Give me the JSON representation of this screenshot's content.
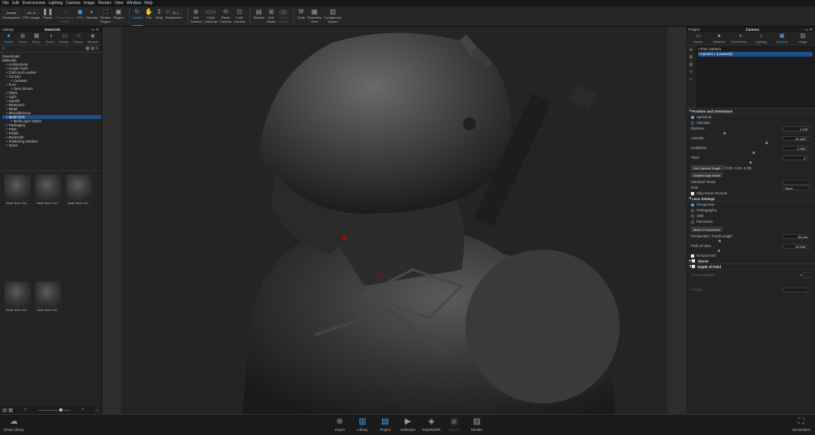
{
  "menu": [
    "File",
    "Edit",
    "Environment",
    "Lighting",
    "Camera",
    "Image",
    "Render",
    "View",
    "Window",
    "Help"
  ],
  "toolbar": {
    "workspace_value": "Default",
    "workspaces_label": "Workspaces",
    "gpu_usage_value": "100 %",
    "gpu_usage_label": "CPU Usage",
    "pause_label": "Pause",
    "performance_mode_label": "Performance\nMode",
    "gpu_label": "GPU",
    "denoise_label": "Denoise",
    "render_region_label": "Render\nRegion",
    "region_label": "Region",
    "tumble_label": "Tumble",
    "pan_label": "Pan",
    "dolly_label": "Dolly",
    "perspective_value": "50.0",
    "perspective_label": "Perspective",
    "add_camera_label": "Add\nCamera",
    "cycle_cameras_label": "Cycle\nCameras",
    "reset_camera_label": "Reset\nCamera",
    "lock_camera_label": "Lock\nCamera",
    "studios_label": "Studios",
    "add_studio_label": "Add\nStudio",
    "cycle_studios_label": "Cycle\nStudios",
    "tools_label": "Tools",
    "geometry_view_label": "Geometry\nView",
    "configurator_wizard_label": "Configurator\nWizard"
  },
  "library": {
    "title": "Library",
    "subtitle": "Materials",
    "tabs": [
      "Materi",
      "Colors",
      "Textu..",
      "Envir..",
      "Backp..",
      "Favori..",
      "Models"
    ],
    "tree": [
      {
        "label": "Downloads",
        "level": 0
      },
      {
        "label": "Materials",
        "level": 0
      },
      {
        "label": "Architectural",
        "level": 1
      },
      {
        "label": "Anodiz Paint",
        "level": 1
      },
      {
        "label": "Cloth and Leather",
        "level": 1
      },
      {
        "label": "Contour",
        "level": 1
      },
      {
        "label": "Cutaway",
        "level": 2
      },
      {
        "label": "Fuzz",
        "level": 1
      },
      {
        "label": "Gem Stones",
        "level": 2
      },
      {
        "label": "Glass",
        "level": 1
      },
      {
        "label": "Light",
        "level": 1
      },
      {
        "label": "Liquids",
        "level": 1
      },
      {
        "label": "Measured",
        "level": 1
      },
      {
        "label": "Metal",
        "level": 1
      },
      {
        "label": "Miscellaneous",
        "level": 1
      },
      {
        "label": "Mold-Tech",
        "level": 1,
        "selected": true
      },
      {
        "label": "Multi-Layer Optics",
        "level": 2
      },
      {
        "label": "Packaging",
        "level": 1
      },
      {
        "label": "Paint",
        "level": 1
      },
      {
        "label": "Plastic",
        "level": 1
      },
      {
        "label": "RealCloth",
        "level": 1
      },
      {
        "label": "Scattering Medium",
        "level": 1
      },
      {
        "label": "Stone",
        "level": 1
      }
    ],
    "thumbnails": [
      "Mold-Tech-110...",
      "Mold-Tech-110...",
      "Mold-Tech-110...",
      "Mold-Tech-110...",
      "Mold-Tech-110..."
    ]
  },
  "project": {
    "title": "Project",
    "subtitle": "Camera",
    "tabs": [
      "Scene",
      "Material",
      "Environme..",
      "Lighting",
      "Camera",
      "Image"
    ],
    "cameras": [
      "Free Camera",
      "Camera 1 (unsaved)"
    ],
    "position_section": "Position and Orientation",
    "spherical_label": "Spherical",
    "absolute_label": "Absolute",
    "distance_label": "Distance",
    "distance_value": "1.126",
    "azimuth_label": "Azimuth",
    "azimuth_value": "52.828 °",
    "inclination_label": "Inclination",
    "inclination_value": "5.963 °",
    "twist_label": "Twist",
    "twist_value": "0 °",
    "set_target_label": "Set Camera Target",
    "target_value": "[-0.03, 1.02, 0.00]",
    "walkthrough_label": "Walkthrough Mode",
    "standard_views_label": "Standard Views",
    "grid_label": "Grid",
    "grid_value": "None",
    "stay_above_label": "Stay Above Ground",
    "lens_section": "Lens Settings",
    "perspective_label": "Perspective",
    "orthographic_label": "Orthographic",
    "shift_label": "Shift",
    "panoramic_label": "Panoramic",
    "match_perspective_label": "Match Perspective",
    "focal_label": "Perspective / Focal Length",
    "focal_value": "50 mm",
    "fov_label": "Field of View",
    "fov_value": "39.598 °",
    "ground_grid_label": "Ground Grid",
    "stereo_label": "Stereo",
    "dof_label": "Depth of Field",
    "focus_distance_label": "Focus Distance",
    "focus_distance_value": "0",
    "fstop_label": "F-Stop",
    "fstop_value": "1"
  },
  "bottombar": {
    "cloud_library": "Cloud Library",
    "import": "Import",
    "library": "Library",
    "project": "Project",
    "animation": "Animation",
    "keyshotxr": "KeyShotXR",
    "render_prev": "KeyVR",
    "render": "Render",
    "screenshot": "Screenshot"
  }
}
